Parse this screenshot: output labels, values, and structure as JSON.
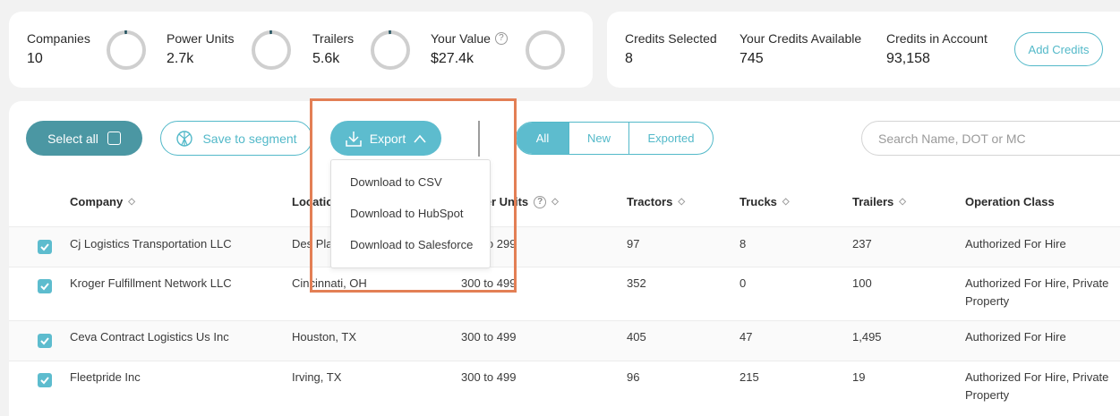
{
  "stats": [
    {
      "label": "Companies",
      "value": "10",
      "help": false,
      "progress": 0.02
    },
    {
      "label": "Power Units",
      "value": "2.7k",
      "help": false,
      "progress": 0.02
    },
    {
      "label": "Trailers",
      "value": "5.6k",
      "help": false,
      "progress": 0.02
    },
    {
      "label": "Your Value",
      "value": "$27.4k",
      "help": true,
      "progress": 0
    }
  ],
  "help_glyph": "?",
  "credits": [
    {
      "label": "Credits Selected",
      "value": "8"
    },
    {
      "label": "Your Credits Available",
      "value": "745"
    },
    {
      "label": "Credits in Account",
      "value": "93,158"
    }
  ],
  "add_credits_label": "Add Credits",
  "toolbar": {
    "select_all": "Select all",
    "save_to_segment": "Save to segment",
    "export": "Export"
  },
  "filter_tabs": [
    {
      "label": "All",
      "active": true
    },
    {
      "label": "New",
      "active": false
    },
    {
      "label": "Exported",
      "active": false
    }
  ],
  "search": {
    "placeholder": "Search Name, DOT or MC"
  },
  "table": {
    "columns": [
      "Company",
      "Location",
      "Power Units",
      "Tractors",
      "Trucks",
      "Trailers",
      "Operation Class"
    ],
    "rows": [
      {
        "checked": true,
        "company": "Cj Logistics Transportation LLC",
        "location": "Des Plaines, IL",
        "power_units": "200 to 299",
        "tractors": "97",
        "trucks": "8",
        "trailers": "237",
        "operation_class": "Authorized For Hire"
      },
      {
        "checked": true,
        "company": "Kroger Fulfillment Network LLC",
        "location": "Cincinnati, OH",
        "power_units": "300 to 499",
        "tractors": "352",
        "trucks": "0",
        "trailers": "100",
        "operation_class": "Authorized For Hire, Private Property"
      },
      {
        "checked": true,
        "company": "Ceva Contract Logistics Us Inc",
        "location": "Houston, TX",
        "power_units": "300 to 499",
        "tractors": "405",
        "trucks": "47",
        "trailers": "1,495",
        "operation_class": "Authorized For Hire"
      },
      {
        "checked": true,
        "company": "Fleetpride Inc",
        "location": "Irving, TX",
        "power_units": "300 to 499",
        "tractors": "96",
        "trucks": "215",
        "trailers": "19",
        "operation_class": "Authorized For Hire, Private Property"
      }
    ]
  },
  "export_menu": [
    "Download to CSV",
    "Download to HubSpot",
    "Download to Salesforce"
  ],
  "colors": {
    "accent": "#5dbcce",
    "accent_dark": "#4b97a3",
    "highlight": "#e37f55",
    "ring": "#cfcfcf",
    "ring_progress": "#1f4f5c"
  },
  "icons": {
    "select_all": "checkbox-icon",
    "save_to_segment": "segment-icon",
    "export": "download-icon",
    "export_toggle": "chevron-up-icon",
    "sort": "sort-icon",
    "row_check": "checkmark-icon"
  }
}
